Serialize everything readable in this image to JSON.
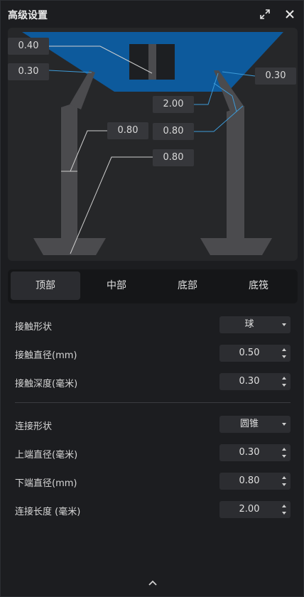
{
  "window": {
    "title": "高级设置"
  },
  "preview": {
    "labels": {
      "top_left_depth": "0.40",
      "left_diameter": "0.30",
      "right_diameter": "0.30",
      "length": "2.00",
      "mid_left": "0.80",
      "mid_right": "0.80",
      "bottom_diameter": "0.80"
    },
    "colors": {
      "platform": "#0d5a9c",
      "support": "#4b4b4e",
      "leader": "#3d9bd8"
    }
  },
  "tabs": [
    {
      "label": "顶部",
      "active": true
    },
    {
      "label": "中部",
      "active": false
    },
    {
      "label": "底部",
      "active": false
    },
    {
      "label": "底筏",
      "active": false
    }
  ],
  "settings": {
    "contact_shape": {
      "label": "接触形状",
      "value": "球"
    },
    "contact_diameter": {
      "label": "接触直径(mm)",
      "value": "0.50"
    },
    "contact_depth": {
      "label": "接触深度(毫米)",
      "value": "0.30"
    },
    "connect_shape": {
      "label": "连接形状",
      "value": "圆锥"
    },
    "upper_diameter": {
      "label": "上端直径(毫米)",
      "value": "0.30"
    },
    "lower_diameter": {
      "label": "下端直径(mm)",
      "value": "0.80"
    },
    "connect_length": {
      "label": "连接长度 (毫米)",
      "value": "2.00"
    }
  }
}
